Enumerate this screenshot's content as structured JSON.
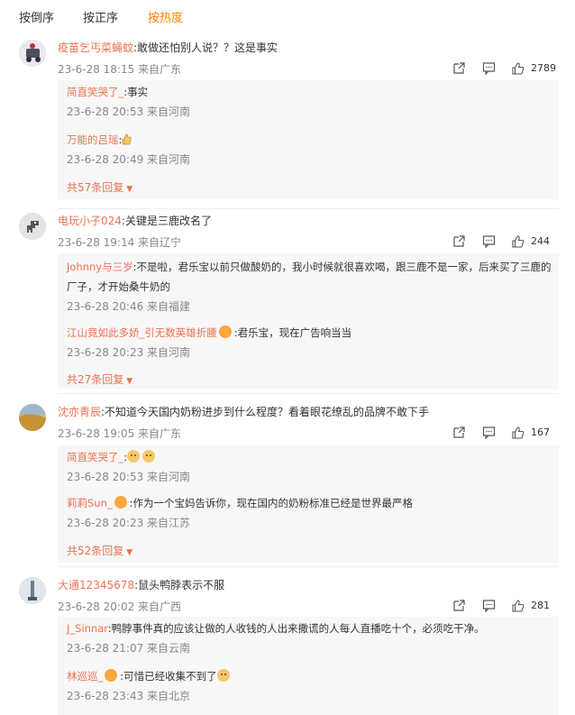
{
  "tabs": [
    {
      "label": "按倒序"
    },
    {
      "label": "按正序"
    },
    {
      "label": "按热度",
      "active": true
    }
  ],
  "colors": {
    "accent": "#ff8200",
    "username": "#eb7350",
    "meta": "#888888",
    "reply_bg": "#f7f7f7"
  },
  "icons": [
    "share-icon",
    "comment-icon",
    "like-icon",
    "chevron-down-icon",
    "crown-badge-icon",
    "emoji-icon",
    "thumbs-up-emoji"
  ],
  "comments": [
    {
      "user": "疫苗乞丐菜蝇蚊",
      "text": ":敢做还怕别人说？？这是事实",
      "meta": "23-6-28 18:15 来自广东",
      "likes": "2789",
      "replies": [
        {
          "user": "简直笑哭了_",
          "text": ":事实",
          "meta": "23-6-28 20:53 来自河南"
        },
        {
          "user": "万能的吕瑶",
          "text": ":",
          "meta": "23-6-28 20:49 来自河南"
        }
      ],
      "more": "共57条回复"
    },
    {
      "user": "电玩小子024",
      "text": ":关键是三鹿改名了",
      "meta": "23-6-28 19:14 来自辽宁",
      "likes": "244",
      "replies": [
        {
          "user": "Johnny与三岁",
          "text": ":不是啦，君乐宝以前只做酸奶的，我小时候就很喜欢喝，跟三鹿不是一家，后来买了三鹿的厂子，才开始桑牛奶的",
          "meta": "23-6-28 20:46 来自福建"
        },
        {
          "user": "江山竟如此多娇_引无数英雄折腰",
          "text": ":君乐宝，现在广告响当当",
          "meta": "23-6-28 20:23 来自河南"
        }
      ],
      "more": "共27条回复"
    },
    {
      "user": "沈亦青辰",
      "text": ":不知道今天国内奶粉进步到什么程度？看着眼花缭乱的品牌不敢下手",
      "meta": "23-6-28 19:05 来自广东",
      "likes": "167",
      "replies": [
        {
          "user": "简直笑哭了_",
          "text": ":",
          "meta": "23-6-28 20:53 来自河南"
        },
        {
          "user": "莉莉Sun_",
          "text": ":作为一个宝妈告诉你，现在国内的奶粉标准已经是世界最严格",
          "meta": "23-6-28 20:23 来自江苏"
        }
      ],
      "more": "共52条回复"
    },
    {
      "user": "大通12345678",
      "text": ":鼠头鸭脖表示不服",
      "meta": "23-6-28 20:02 来自广西",
      "likes": "281",
      "replies": [
        {
          "user": "J_Sinnar",
          "text": ":鸭脖事件真的应该让做的人收钱的人出来撒谎的人每人直播吃十个，必须吃干净。",
          "meta": "23-6-28 21:07 来自云南"
        },
        {
          "user": "林巡巡_",
          "text": ":可惜已经收集不到了",
          "meta": "23-6-28 23:43 来自北京"
        }
      ],
      "more": ""
    }
  ]
}
